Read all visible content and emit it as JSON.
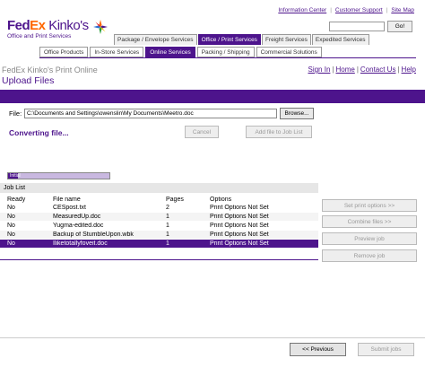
{
  "logo": {
    "fed": "Fed",
    "ex": "Ex",
    "kinkos": " Kinko's",
    "sub": "Office and Print Services"
  },
  "toplinks": [
    "Information Center",
    "Customer Support",
    "Site Map"
  ],
  "search": {
    "value": "",
    "go_label": "Go!"
  },
  "tabs": [
    "Package / Envelope Services",
    "Office / Print Services",
    "Freight Services",
    "Expedited Services"
  ],
  "subtabs": [
    "Office Products",
    "In-Store Services",
    "Online Services",
    "Packing / Shipping",
    "Commercial Solutions"
  ],
  "header": {
    "brand": "FedEx Kinko's Print Online",
    "title": "Upload Files",
    "links": [
      "Sign In",
      "Home",
      "Contact Us",
      "Help"
    ]
  },
  "file": {
    "label": "File:",
    "path": "C:\\Documents and Settings\\owenslin\\My Documents\\Meetro.doc",
    "browse_label": "Browse..."
  },
  "status": {
    "text": "Converting file...",
    "cancel_label": "Cancel",
    "add_label": "Add file to Job List"
  },
  "progress": {
    "label": "Initial",
    "fraction": 0.1
  },
  "joblist": {
    "title": "Job List",
    "columns": [
      "Ready",
      "File name",
      "Pages",
      "Options"
    ],
    "rows": [
      {
        "ready": "No",
        "name": "CESpost.txt",
        "pages": "2",
        "options": "Print Options Not Set"
      },
      {
        "ready": "No",
        "name": "MeasuredUp.doc",
        "pages": "1",
        "options": "Print Options Not Set"
      },
      {
        "ready": "No",
        "name": "Yugma-edited.doc",
        "pages": "1",
        "options": "Print Options Not Set"
      },
      {
        "ready": "No",
        "name": "Backup of StumbleUpon.wbk",
        "pages": "1",
        "options": "Print Options Not Set"
      },
      {
        "ready": "No",
        "name": "Iliketotallyfoveit.doc",
        "pages": "1",
        "options": "Print Options Not Set"
      }
    ]
  },
  "side_buttons": [
    "Set print options >>",
    "Combine files >>",
    "Preview job",
    "Remove job"
  ],
  "footer": {
    "previous_label": "<< Previous",
    "submit_label": "Submit jobs"
  },
  "colors": {
    "brand_purple": "#4d148c",
    "brand_orange": "#ff6600"
  }
}
